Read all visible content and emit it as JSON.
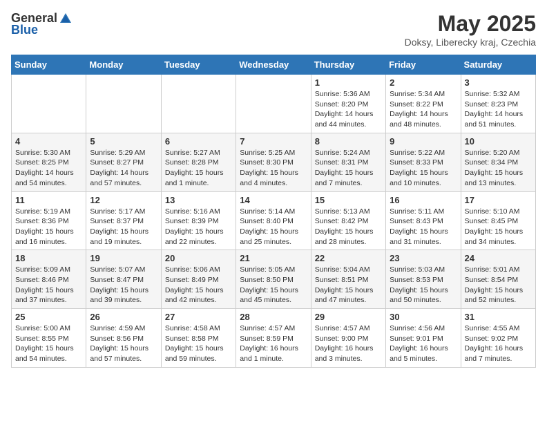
{
  "header": {
    "logo_general": "General",
    "logo_blue": "Blue",
    "month_title": "May 2025",
    "subtitle": "Doksy, Liberecky kraj, Czechia"
  },
  "days_of_week": [
    "Sunday",
    "Monday",
    "Tuesday",
    "Wednesday",
    "Thursday",
    "Friday",
    "Saturday"
  ],
  "weeks": [
    [
      {
        "day": "",
        "info": ""
      },
      {
        "day": "",
        "info": ""
      },
      {
        "day": "",
        "info": ""
      },
      {
        "day": "",
        "info": ""
      },
      {
        "day": "1",
        "info": "Sunrise: 5:36 AM\nSunset: 8:20 PM\nDaylight: 14 hours\nand 44 minutes."
      },
      {
        "day": "2",
        "info": "Sunrise: 5:34 AM\nSunset: 8:22 PM\nDaylight: 14 hours\nand 48 minutes."
      },
      {
        "day": "3",
        "info": "Sunrise: 5:32 AM\nSunset: 8:23 PM\nDaylight: 14 hours\nand 51 minutes."
      }
    ],
    [
      {
        "day": "4",
        "info": "Sunrise: 5:30 AM\nSunset: 8:25 PM\nDaylight: 14 hours\nand 54 minutes."
      },
      {
        "day": "5",
        "info": "Sunrise: 5:29 AM\nSunset: 8:27 PM\nDaylight: 14 hours\nand 57 minutes."
      },
      {
        "day": "6",
        "info": "Sunrise: 5:27 AM\nSunset: 8:28 PM\nDaylight: 15 hours\nand 1 minute."
      },
      {
        "day": "7",
        "info": "Sunrise: 5:25 AM\nSunset: 8:30 PM\nDaylight: 15 hours\nand 4 minutes."
      },
      {
        "day": "8",
        "info": "Sunrise: 5:24 AM\nSunset: 8:31 PM\nDaylight: 15 hours\nand 7 minutes."
      },
      {
        "day": "9",
        "info": "Sunrise: 5:22 AM\nSunset: 8:33 PM\nDaylight: 15 hours\nand 10 minutes."
      },
      {
        "day": "10",
        "info": "Sunrise: 5:20 AM\nSunset: 8:34 PM\nDaylight: 15 hours\nand 13 minutes."
      }
    ],
    [
      {
        "day": "11",
        "info": "Sunrise: 5:19 AM\nSunset: 8:36 PM\nDaylight: 15 hours\nand 16 minutes."
      },
      {
        "day": "12",
        "info": "Sunrise: 5:17 AM\nSunset: 8:37 PM\nDaylight: 15 hours\nand 19 minutes."
      },
      {
        "day": "13",
        "info": "Sunrise: 5:16 AM\nSunset: 8:39 PM\nDaylight: 15 hours\nand 22 minutes."
      },
      {
        "day": "14",
        "info": "Sunrise: 5:14 AM\nSunset: 8:40 PM\nDaylight: 15 hours\nand 25 minutes."
      },
      {
        "day": "15",
        "info": "Sunrise: 5:13 AM\nSunset: 8:42 PM\nDaylight: 15 hours\nand 28 minutes."
      },
      {
        "day": "16",
        "info": "Sunrise: 5:11 AM\nSunset: 8:43 PM\nDaylight: 15 hours\nand 31 minutes."
      },
      {
        "day": "17",
        "info": "Sunrise: 5:10 AM\nSunset: 8:45 PM\nDaylight: 15 hours\nand 34 minutes."
      }
    ],
    [
      {
        "day": "18",
        "info": "Sunrise: 5:09 AM\nSunset: 8:46 PM\nDaylight: 15 hours\nand 37 minutes."
      },
      {
        "day": "19",
        "info": "Sunrise: 5:07 AM\nSunset: 8:47 PM\nDaylight: 15 hours\nand 39 minutes."
      },
      {
        "day": "20",
        "info": "Sunrise: 5:06 AM\nSunset: 8:49 PM\nDaylight: 15 hours\nand 42 minutes."
      },
      {
        "day": "21",
        "info": "Sunrise: 5:05 AM\nSunset: 8:50 PM\nDaylight: 15 hours\nand 45 minutes."
      },
      {
        "day": "22",
        "info": "Sunrise: 5:04 AM\nSunset: 8:51 PM\nDaylight: 15 hours\nand 47 minutes."
      },
      {
        "day": "23",
        "info": "Sunrise: 5:03 AM\nSunset: 8:53 PM\nDaylight: 15 hours\nand 50 minutes."
      },
      {
        "day": "24",
        "info": "Sunrise: 5:01 AM\nSunset: 8:54 PM\nDaylight: 15 hours\nand 52 minutes."
      }
    ],
    [
      {
        "day": "25",
        "info": "Sunrise: 5:00 AM\nSunset: 8:55 PM\nDaylight: 15 hours\nand 54 minutes."
      },
      {
        "day": "26",
        "info": "Sunrise: 4:59 AM\nSunset: 8:56 PM\nDaylight: 15 hours\nand 57 minutes."
      },
      {
        "day": "27",
        "info": "Sunrise: 4:58 AM\nSunset: 8:58 PM\nDaylight: 15 hours\nand 59 minutes."
      },
      {
        "day": "28",
        "info": "Sunrise: 4:57 AM\nSunset: 8:59 PM\nDaylight: 16 hours\nand 1 minute."
      },
      {
        "day": "29",
        "info": "Sunrise: 4:57 AM\nSunset: 9:00 PM\nDaylight: 16 hours\nand 3 minutes."
      },
      {
        "day": "30",
        "info": "Sunrise: 4:56 AM\nSunset: 9:01 PM\nDaylight: 16 hours\nand 5 minutes."
      },
      {
        "day": "31",
        "info": "Sunrise: 4:55 AM\nSunset: 9:02 PM\nDaylight: 16 hours\nand 7 minutes."
      }
    ]
  ]
}
